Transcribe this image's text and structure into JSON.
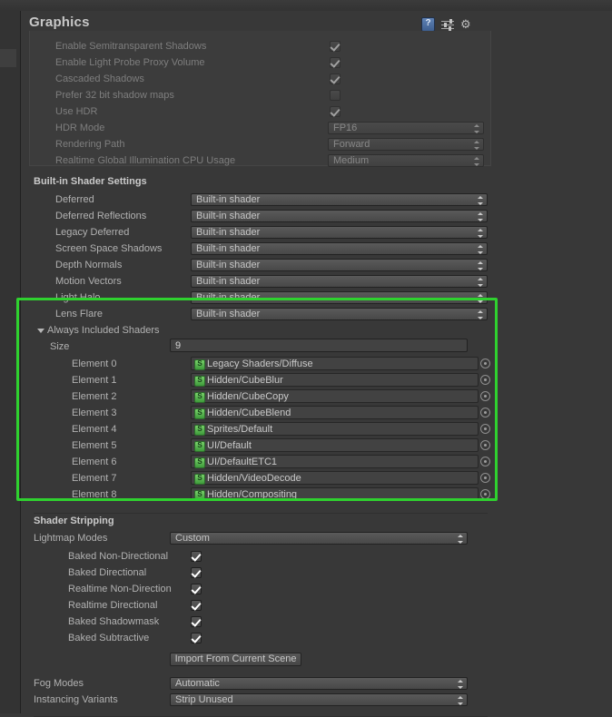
{
  "window": {
    "panel_title": "Graphics",
    "highlight_color": "#2fd12f",
    "background_color": "#383838",
    "icons": [
      {
        "name": "help-icon",
        "glyph": "?"
      },
      {
        "name": "preset-icon",
        "glyph": "preset"
      },
      {
        "name": "gear-icon",
        "glyph": "⚙"
      }
    ]
  },
  "tier_settings": {
    "rows": [
      {
        "label": "Enable Semitransparent Shadows",
        "type": "checkbox",
        "value": true,
        "disabled": true
      },
      {
        "label": "Enable Light Probe Proxy Volume",
        "type": "checkbox",
        "value": true,
        "disabled": true
      },
      {
        "label": "Cascaded Shadows",
        "type": "checkbox",
        "value": true,
        "disabled": true
      },
      {
        "label": "Prefer 32 bit shadow maps",
        "type": "checkbox",
        "value": false,
        "disabled": true
      },
      {
        "label": "Use HDR",
        "type": "checkbox",
        "value": true,
        "disabled": true
      },
      {
        "label": "HDR Mode",
        "type": "dropdown",
        "value": "FP16",
        "disabled": true
      },
      {
        "label": "Rendering Path",
        "type": "dropdown",
        "value": "Forward",
        "disabled": true
      },
      {
        "label": "Realtime Global Illumination CPU Usage",
        "type": "dropdown",
        "value": "Medium",
        "disabled": true
      }
    ]
  },
  "builtin_shader_settings": {
    "header": "Built-in Shader Settings",
    "rows": [
      {
        "label": "Deferred",
        "value": "Built-in shader"
      },
      {
        "label": "Deferred Reflections",
        "value": "Built-in shader"
      },
      {
        "label": "Legacy Deferred",
        "value": "Built-in shader"
      },
      {
        "label": "Screen Space Shadows",
        "value": "Built-in shader"
      },
      {
        "label": "Depth Normals",
        "value": "Built-in shader"
      },
      {
        "label": "Motion Vectors",
        "value": "Built-in shader"
      },
      {
        "label": "Light Halo",
        "value": "Built-in shader"
      },
      {
        "label": "Lens Flare",
        "value": "Built-in shader"
      }
    ]
  },
  "always_included_shaders": {
    "header": "Always Included Shaders",
    "expanded": true,
    "size_label": "Size",
    "size_value": "9",
    "elements": [
      {
        "label": "Element 0",
        "value": "Legacy Shaders/Diffuse"
      },
      {
        "label": "Element 1",
        "value": "Hidden/CubeBlur"
      },
      {
        "label": "Element 2",
        "value": "Hidden/CubeCopy"
      },
      {
        "label": "Element 3",
        "value": "Hidden/CubeBlend"
      },
      {
        "label": "Element 4",
        "value": "Sprites/Default"
      },
      {
        "label": "Element 5",
        "value": "UI/Default"
      },
      {
        "label": "Element 6",
        "value": "UI/DefaultETC1"
      },
      {
        "label": "Element 7",
        "value": "Hidden/VideoDecode"
      },
      {
        "label": "Element 8",
        "value": "Hidden/Compositing"
      }
    ]
  },
  "shader_stripping": {
    "header": "Shader Stripping",
    "lightmap_modes_label": "Lightmap Modes",
    "lightmap_modes_value": "Custom",
    "lightmap_options": [
      {
        "label": "Baked Non-Directional",
        "value": true
      },
      {
        "label": "Baked Directional",
        "value": true
      },
      {
        "label": "Realtime Non-Direction",
        "value": true
      },
      {
        "label": "Realtime Directional",
        "value": true
      },
      {
        "label": "Baked Shadowmask",
        "value": true
      },
      {
        "label": "Baked Subtractive",
        "value": true
      }
    ],
    "import_button": "Import From Current Scene",
    "fog_modes_label": "Fog Modes",
    "fog_modes_value": "Automatic",
    "instancing_label": "Instancing Variants",
    "instancing_value": "Strip Unused"
  }
}
